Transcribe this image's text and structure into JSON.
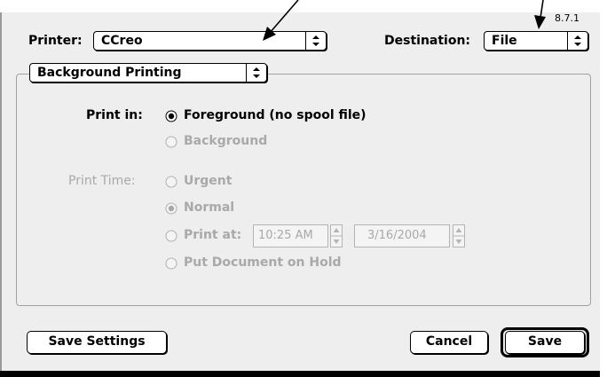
{
  "version": "8.7.1",
  "printer": {
    "label": "Printer:",
    "value": "CCreo"
  },
  "destination": {
    "label": "Destination:",
    "value": "File"
  },
  "panel_popup": {
    "value": "Background Printing"
  },
  "print_in": {
    "label": "Print in:",
    "options": [
      {
        "label": "Foreground (no spool file)",
        "selected": true,
        "enabled": true
      },
      {
        "label": "Background",
        "selected": false,
        "enabled": false
      }
    ]
  },
  "print_time": {
    "label": "Print Time:",
    "options": [
      {
        "label": "Urgent",
        "selected": false,
        "enabled": false
      },
      {
        "label": "Normal",
        "selected": true,
        "enabled": false
      },
      {
        "label": "Print at:",
        "selected": false,
        "enabled": false
      },
      {
        "label": "Put Document on Hold",
        "selected": false,
        "enabled": false
      }
    ],
    "time_value": "10:25 AM",
    "date_value": "3/16/2004"
  },
  "buttons": {
    "save_settings": "Save Settings",
    "cancel": "Cancel",
    "save": "Save"
  },
  "colors": {
    "dialog_bg": "#eeeeee",
    "disabled_text": "#a9a9a9",
    "frame": "#000000"
  }
}
